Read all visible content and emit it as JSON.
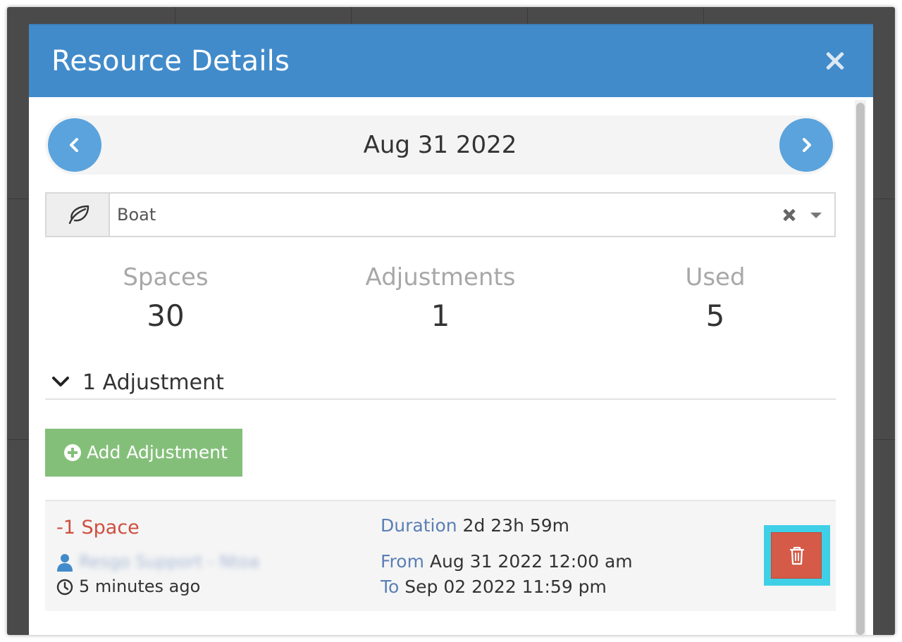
{
  "modal": {
    "title": "Resource Details"
  },
  "date_nav": {
    "date": "Aug 31 2022"
  },
  "resource_select": {
    "value": "Boat"
  },
  "stats": {
    "spaces": {
      "label": "Spaces",
      "value": "30"
    },
    "adjustments": {
      "label": "Adjustments",
      "value": "1"
    },
    "used": {
      "label": "Used",
      "value": "5"
    }
  },
  "adjustments_section": {
    "header": "1 Adjustment",
    "add_button": "Add Adjustment",
    "items": [
      {
        "amount": "-1 Space",
        "user": "Resgo Support - Ntoa",
        "created": "5 minutes ago",
        "duration_label": "Duration",
        "duration_value": "2d 23h 59m",
        "from_label": "From",
        "from_value": "Aug 31 2022 12:00 am",
        "to_label": "To",
        "to_value": "Sep 02 2022 11:59 pm"
      }
    ]
  },
  "colors": {
    "header": "#428bca",
    "nav_button": "#5ba3dc",
    "add_button": "#84bf7a",
    "delete_button": "#d55a48",
    "amount_text": "#cf4e3f",
    "highlight": "#3fd0e8"
  },
  "icons": {
    "close": "close-icon",
    "prev": "chevron-left-icon",
    "next": "chevron-right-icon",
    "resource": "leaf-icon",
    "clear": "clear-icon",
    "caret": "caret-down-icon",
    "collapse": "chevron-down-icon",
    "add": "plus-circle-icon",
    "user": "user-icon",
    "time": "clock-icon",
    "delete": "trash-icon"
  }
}
